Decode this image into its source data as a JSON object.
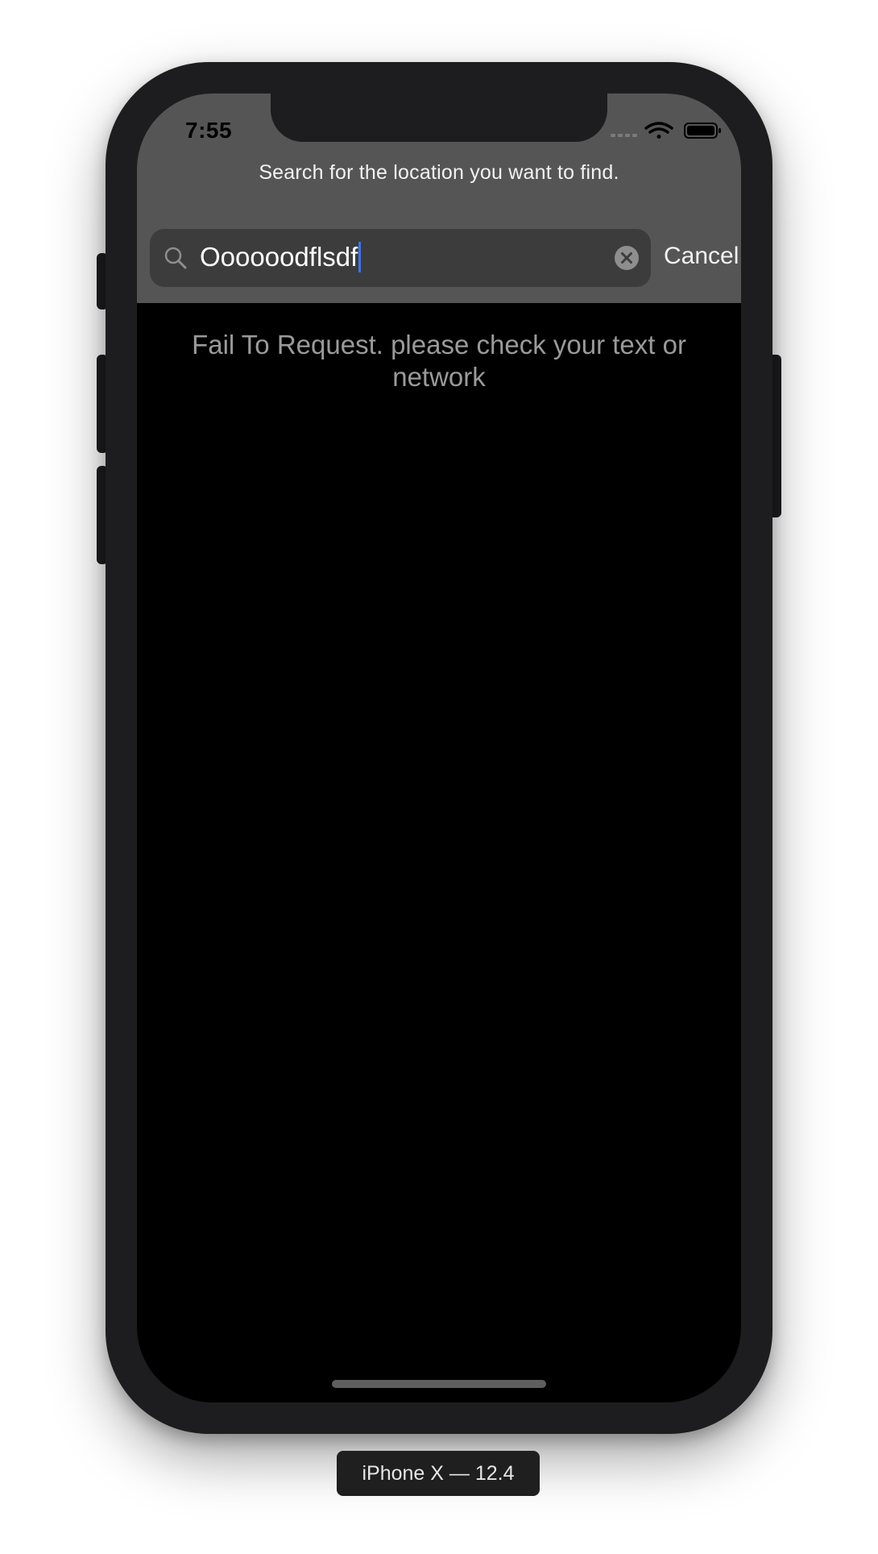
{
  "status_bar": {
    "time": "7:55",
    "wifi_icon": "wifi-icon",
    "battery_icon": "battery-icon",
    "signal_icon": "cellular-signal-icon"
  },
  "header": {
    "prompt": "Search for the location you want to find."
  },
  "search": {
    "value": "Oooooodflsdf",
    "search_icon": "search-icon",
    "clear_icon": "clear-icon",
    "cancel_label": "Cancel"
  },
  "main": {
    "message": "Fail To Request. please check your text or network"
  },
  "simulator": {
    "device_label": "iPhone X — 12.4"
  },
  "colors": {
    "header_bg": "#555555",
    "field_bg": "#3c3c3c",
    "caret": "#3f73e6",
    "screen_bg": "#000000",
    "message_text": "#9a9a9a"
  }
}
